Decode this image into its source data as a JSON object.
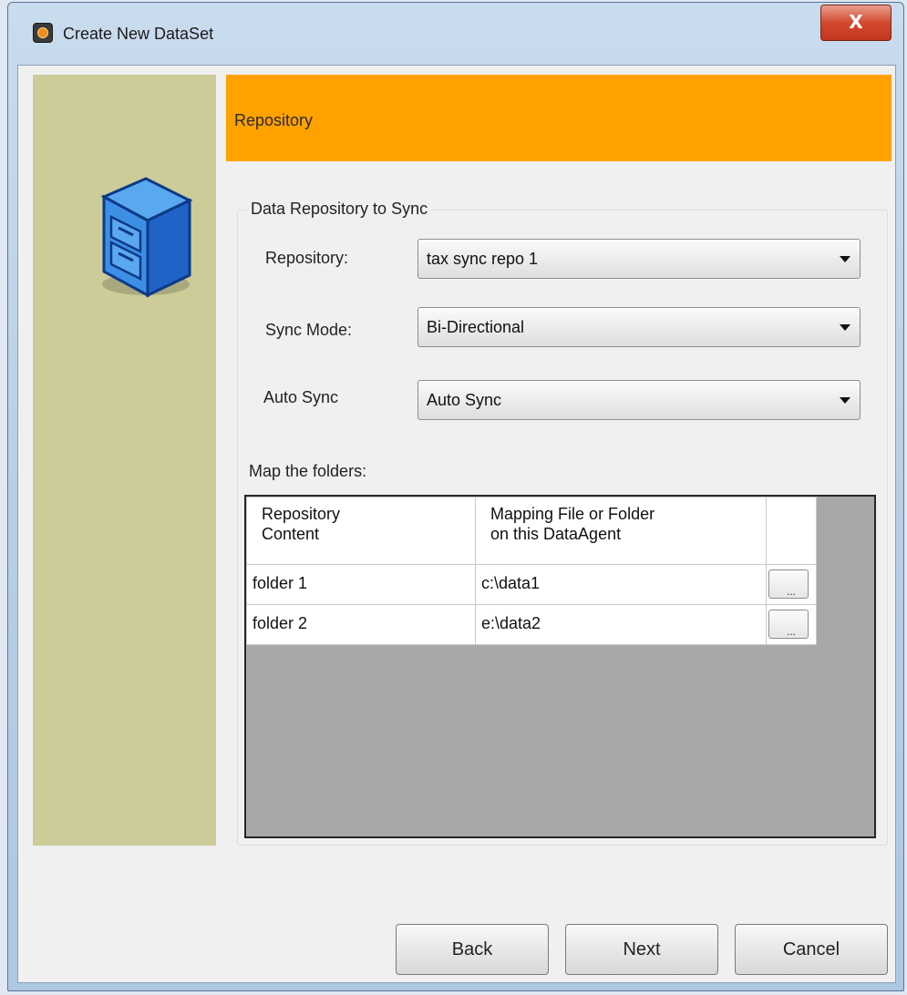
{
  "window": {
    "title": "Create New DataSet",
    "close_label": "X"
  },
  "header": {
    "title": "Repository"
  },
  "group": {
    "title": "Data Repository to Sync",
    "fields": [
      {
        "label": "Repository:",
        "value": "tax sync repo 1"
      },
      {
        "label": "Sync Mode:",
        "value": "Bi-Directional"
      },
      {
        "label": "Auto Sync",
        "value": "Auto Sync"
      }
    ]
  },
  "mapping": {
    "label": "Map the folders:",
    "columns": [
      "Repository\nContent",
      "Mapping File or Folder\non this DataAgent",
      ""
    ],
    "rows": [
      {
        "content": "folder 1",
        "path": "c:\\data1",
        "browse": "..."
      },
      {
        "content": "folder 2",
        "path": "e:\\data2",
        "browse": "..."
      }
    ]
  },
  "footer": {
    "back": "Back",
    "next": "Next",
    "cancel": "Cancel"
  },
  "colors": {
    "sidebar": "#cccc99",
    "header_band": "#ffa200",
    "table_bg": "#a8a8a8"
  },
  "icons": {
    "app": "app-logo-icon",
    "cabinet": "file-cabinet-icon"
  }
}
